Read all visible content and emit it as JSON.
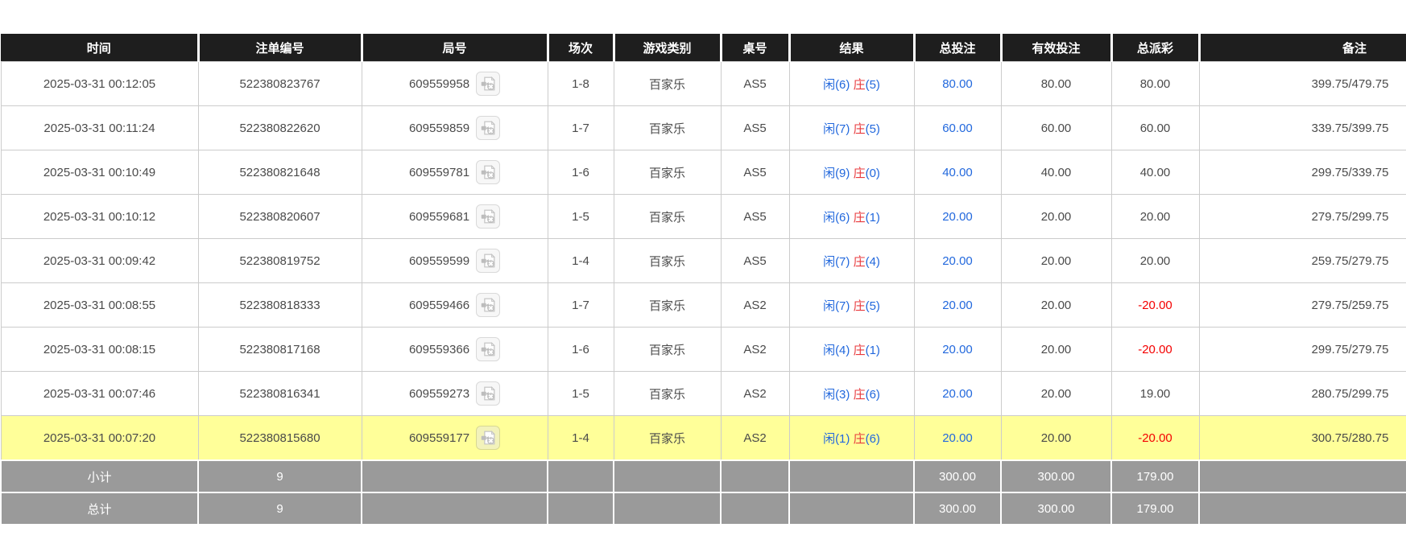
{
  "colors": {
    "header_bg": "#1e1e1e",
    "row_highlight": "#ffff99",
    "footer_bg": "#9a9a9a",
    "bet_link_blue": "#2268dd",
    "banker_red": "#e8393c",
    "negative_red": "#f40000"
  },
  "icons": {
    "round_video_icon": "video-file-replay"
  },
  "table": {
    "columns": [
      {
        "label": "时间"
      },
      {
        "label": "注单编号"
      },
      {
        "label": "局号"
      },
      {
        "label": "场次"
      },
      {
        "label": "游戏类别"
      },
      {
        "label": "桌号"
      },
      {
        "label": "结果"
      },
      {
        "label": "总投注"
      },
      {
        "label": "有效投注"
      },
      {
        "label": "总派彩"
      },
      {
        "label": "备注"
      }
    ],
    "highlighted_row_index": 8,
    "rows": [
      {
        "time": "2025-03-31 00:12:05",
        "bet_id": "522380823767",
        "round_no": "609559958",
        "session": "1-8",
        "game_type": "百家乐",
        "table_no": "AS5",
        "result": {
          "player": "闲(6)",
          "banker": "庄",
          "banker_score": "(5)"
        },
        "total_bet": "80.00",
        "valid_bet": "80.00",
        "payout": "80.00",
        "remark": "399.75/479.75"
      },
      {
        "time": "2025-03-31 00:11:24",
        "bet_id": "522380822620",
        "round_no": "609559859",
        "session": "1-7",
        "game_type": "百家乐",
        "table_no": "AS5",
        "result": {
          "player": "闲(7)",
          "banker": "庄",
          "banker_score": "(5)"
        },
        "total_bet": "60.00",
        "valid_bet": "60.00",
        "payout": "60.00",
        "remark": "339.75/399.75"
      },
      {
        "time": "2025-03-31 00:10:49",
        "bet_id": "522380821648",
        "round_no": "609559781",
        "session": "1-6",
        "game_type": "百家乐",
        "table_no": "AS5",
        "result": {
          "player": "闲(9)",
          "banker": "庄",
          "banker_score": "(0)"
        },
        "total_bet": "40.00",
        "valid_bet": "40.00",
        "payout": "40.00",
        "remark": "299.75/339.75"
      },
      {
        "time": "2025-03-31 00:10:12",
        "bet_id": "522380820607",
        "round_no": "609559681",
        "session": "1-5",
        "game_type": "百家乐",
        "table_no": "AS5",
        "result": {
          "player": "闲(6)",
          "banker": "庄",
          "banker_score": "(1)"
        },
        "total_bet": "20.00",
        "valid_bet": "20.00",
        "payout": "20.00",
        "remark": "279.75/299.75"
      },
      {
        "time": "2025-03-31 00:09:42",
        "bet_id": "522380819752",
        "round_no": "609559599",
        "session": "1-4",
        "game_type": "百家乐",
        "table_no": "AS5",
        "result": {
          "player": "闲(7)",
          "banker": "庄",
          "banker_score": "(4)"
        },
        "total_bet": "20.00",
        "valid_bet": "20.00",
        "payout": "20.00",
        "remark": "259.75/279.75"
      },
      {
        "time": "2025-03-31 00:08:55",
        "bet_id": "522380818333",
        "round_no": "609559466",
        "session": "1-7",
        "game_type": "百家乐",
        "table_no": "AS2",
        "result": {
          "player": "闲(7)",
          "banker": "庄",
          "banker_score": "(5)"
        },
        "total_bet": "20.00",
        "valid_bet": "20.00",
        "payout": "-20.00",
        "remark": "279.75/259.75"
      },
      {
        "time": "2025-03-31 00:08:15",
        "bet_id": "522380817168",
        "round_no": "609559366",
        "session": "1-6",
        "game_type": "百家乐",
        "table_no": "AS2",
        "result": {
          "player": "闲(4)",
          "banker": "庄",
          "banker_score": "(1)"
        },
        "total_bet": "20.00",
        "valid_bet": "20.00",
        "payout": "-20.00",
        "remark": "299.75/279.75"
      },
      {
        "time": "2025-03-31 00:07:46",
        "bet_id": "522380816341",
        "round_no": "609559273",
        "session": "1-5",
        "game_type": "百家乐",
        "table_no": "AS2",
        "result": {
          "player": "闲(3)",
          "banker": "庄",
          "banker_score": "(6)"
        },
        "total_bet": "20.00",
        "valid_bet": "20.00",
        "payout": "19.00",
        "remark": "280.75/299.75"
      },
      {
        "time": "2025-03-31 00:07:20",
        "bet_id": "522380815680",
        "round_no": "609559177",
        "session": "1-4",
        "game_type": "百家乐",
        "table_no": "AS2",
        "result": {
          "player": "闲(1)",
          "banker": "庄",
          "banker_score": "(6)"
        },
        "total_bet": "20.00",
        "valid_bet": "20.00",
        "payout": "-20.00",
        "remark": "300.75/280.75"
      }
    ],
    "footer": [
      {
        "label": "小计",
        "count": "9",
        "total_bet": "300.00",
        "valid_bet": "300.00",
        "payout": "179.00"
      },
      {
        "label": "总计",
        "count": "9",
        "total_bet": "300.00",
        "valid_bet": "300.00",
        "payout": "179.00"
      }
    ]
  }
}
